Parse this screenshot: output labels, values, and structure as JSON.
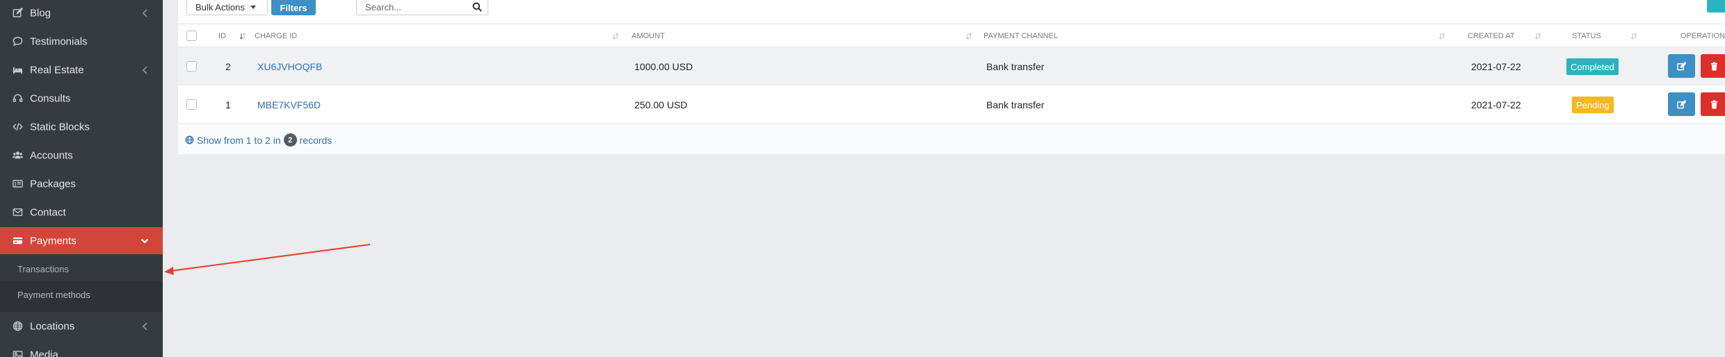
{
  "sidebar": {
    "items": [
      {
        "label": "Blog",
        "icon": "edit-icon",
        "has_chevron": true
      },
      {
        "label": "Testimonials",
        "icon": "comment-icon",
        "has_chevron": false
      },
      {
        "label": "Real Estate",
        "icon": "bed-icon",
        "has_chevron": true
      },
      {
        "label": "Consults",
        "icon": "headset-icon",
        "has_chevron": false
      },
      {
        "label": "Static Blocks",
        "icon": "code-icon",
        "has_chevron": false
      },
      {
        "label": "Accounts",
        "icon": "users-icon",
        "has_chevron": false
      },
      {
        "label": "Packages",
        "icon": "package-icon",
        "has_chevron": false
      },
      {
        "label": "Contact",
        "icon": "envelope-icon",
        "has_chevron": false
      },
      {
        "label": "Payments",
        "icon": "credit-card-icon",
        "has_chevron": true,
        "active": true
      },
      {
        "label": "Locations",
        "icon": "globe-icon",
        "has_chevron": true
      },
      {
        "label": "Media",
        "icon": "image-icon",
        "has_chevron": false
      }
    ],
    "payments_submenu": [
      {
        "label": "Transactions",
        "current": true
      },
      {
        "label": "Payment methods",
        "current": false
      }
    ]
  },
  "toolbar": {
    "bulk_actions_label": "Bulk Actions",
    "filters_label": "Filters",
    "search_placeholder": "Search..."
  },
  "table": {
    "columns": {
      "id": "ID",
      "charge_id": "CHARGE ID",
      "amount": "AMOUNT",
      "payment_channel": "PAYMENT CHANNEL",
      "created_at": "CREATED AT",
      "status": "STATUS",
      "operations": "OPERATIONS"
    },
    "rows": [
      {
        "id": "2",
        "charge_id": "XU6JVHOQFB",
        "amount": "1000.00 USD",
        "payment_channel": "Bank transfer",
        "created_at": "2021-07-22",
        "status": "Completed"
      },
      {
        "id": "1",
        "charge_id": "MBE7KVF56D",
        "amount": "250.00 USD",
        "payment_channel": "Bank transfer",
        "created_at": "2021-07-22",
        "status": "Pending"
      }
    ],
    "footer": {
      "prefix": "Show from 1 to 2 in",
      "count": "2",
      "suffix": "records"
    }
  },
  "colors": {
    "sidebar_bg": "#363b40",
    "active_nav": "#d1453b",
    "primary_blue": "#3d8fc4",
    "status_completed": "#2bb3c0",
    "status_pending": "#f5b81d",
    "danger_red": "#d9302b",
    "annotation_arrow": "#e5402f"
  }
}
